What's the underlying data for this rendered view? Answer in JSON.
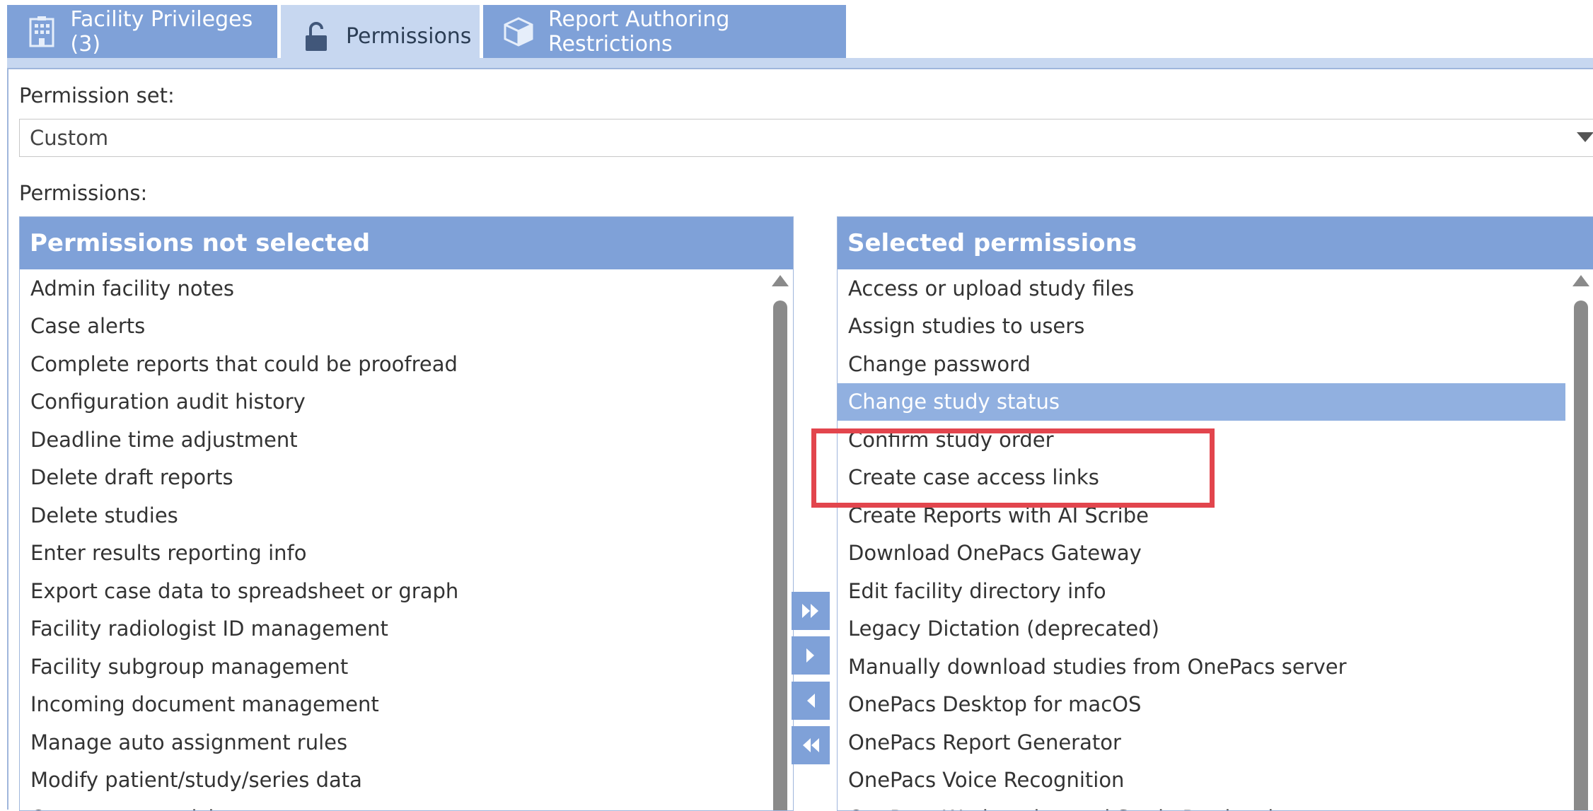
{
  "tabs": [
    {
      "label": "Facility Privileges (3)",
      "icon": "building-icon",
      "active": false
    },
    {
      "label": "Permissions",
      "icon": "unlock-icon",
      "active": true
    },
    {
      "label": "Report Authoring Restrictions",
      "icon": "box-icon",
      "active": false
    }
  ],
  "permission_set": {
    "label": "Permission set:",
    "value": "Custom"
  },
  "permissions_label": "Permissions:",
  "not_selected": {
    "header": "Permissions not selected",
    "items": [
      "Admin facility notes",
      "Case alerts",
      "Complete reports that could be proofread",
      "Configuration audit history",
      "Deadline time adjustment",
      "Delete draft reports",
      "Delete studies",
      "Enter results reporting info",
      "Export case data to spreadsheet or graph",
      "Facility radiologist ID management",
      "Facility subgroup management",
      "Incoming document management",
      "Manage auto assignment rules",
      "Modify patient/study/series data",
      "Overcomment tickets"
    ]
  },
  "selected": {
    "header": "Selected permissions",
    "items": [
      "Access or upload study files",
      "Assign studies to users",
      "Change password",
      "Change study status",
      "Confirm study order",
      "Create case access links",
      "Create Reports with AI Scribe",
      "Download OnePacs Gateway",
      "Edit facility directory info",
      "Legacy Dictation (deprecated)",
      "Manually download studies from OnePacs server",
      "OnePacs Desktop for macOS",
      "OnePacs Report Generator",
      "OnePacs Voice Recognition",
      "OnePacs Workstation and Study Retrieval"
    ],
    "highlighted_item": "Change study status"
  },
  "colors": {
    "accent": "#7fa1d8",
    "tab_active": "#c7d7f0",
    "row_selected": "#91b0e0",
    "annotation": "#e2454d"
  }
}
